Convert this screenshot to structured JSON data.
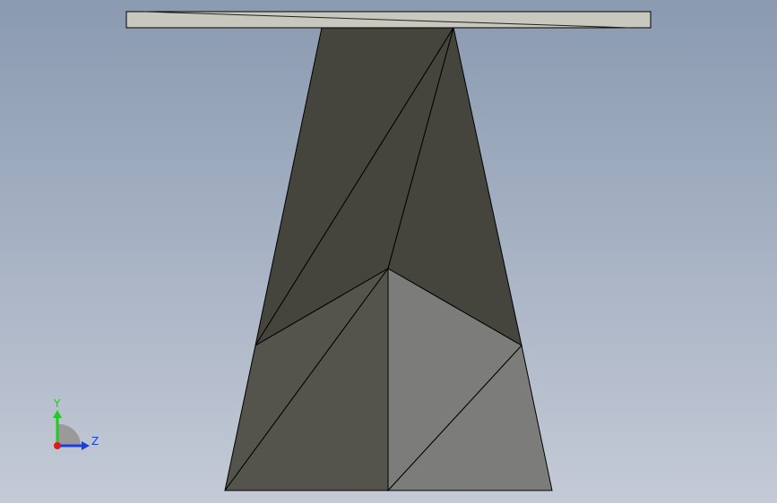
{
  "viewport": {
    "background_top": "#8a9ab0",
    "background_bottom": "#c4cad6"
  },
  "model": {
    "plate_color": "#c8c8be",
    "face_dark": "#45453e",
    "face_mid": "#54544c",
    "face_light": "#7c7c7a",
    "edge_color": "#000000"
  },
  "triad": {
    "y_label": "Y",
    "z_label": "Z",
    "y_color": "#1fcc1f",
    "z_color": "#1a3fe0",
    "x_color": "#e01818",
    "y_icon": "arrow-up-icon",
    "z_icon": "arrow-right-icon",
    "origin_icon": "origin-dot-icon"
  }
}
